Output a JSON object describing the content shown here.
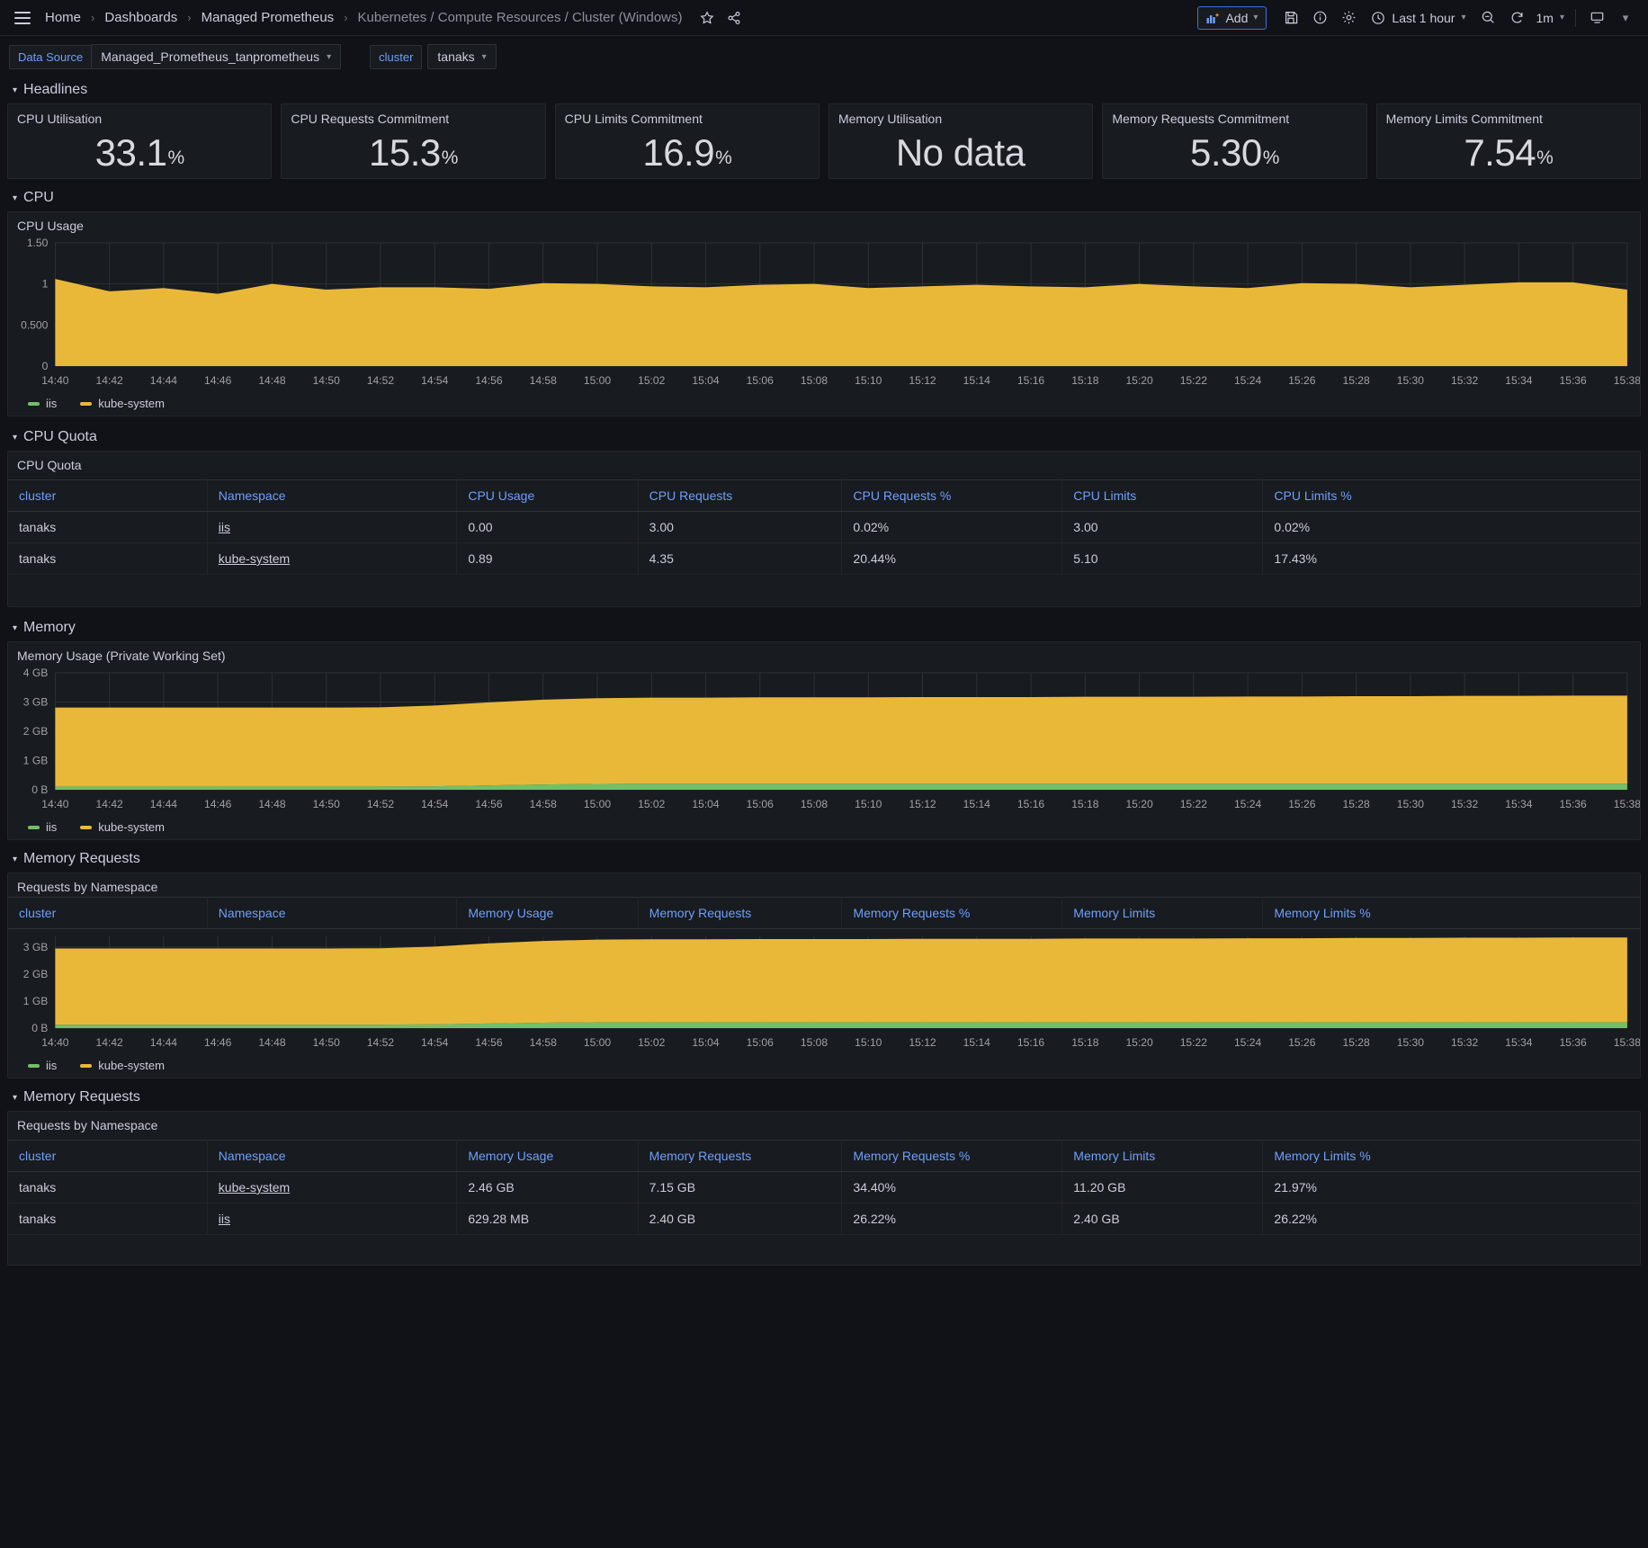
{
  "topbar": {
    "menu_icon": "hamburger-icon",
    "breadcrumbs": [
      {
        "label": "Home"
      },
      {
        "label": "Dashboards"
      },
      {
        "label": "Managed Prometheus"
      },
      {
        "label": "Kubernetes / Compute Resources / Cluster (Windows)"
      }
    ],
    "separator": "›",
    "star_icon": "☆",
    "share_icon": "share-icon",
    "add_label": "Add",
    "save_icon": "save-icon",
    "info_icon": "info-icon",
    "settings_icon": "gear-icon",
    "time_range": "Last 1 hour",
    "zoom_out_icon": "zoom-out-icon",
    "refresh_icon": "refresh-icon",
    "refresh_interval": "1m",
    "kiosk_icon": "tv-icon",
    "chevron": "⌄"
  },
  "variables": {
    "datasource_label": "Data Source",
    "datasource_value": "Managed_Prometheus_tanprometheus",
    "cluster_label": "cluster",
    "cluster_value": "tanaks"
  },
  "rows": {
    "headlines": "Headlines",
    "cpu": "CPU",
    "cpu_quota": "CPU Quota",
    "memory": "Memory",
    "memory_requests": "Memory Requests",
    "memory_requests2": "Memory Requests"
  },
  "stats": [
    {
      "title": "CPU Utilisation",
      "value": "33.1",
      "unit": "%"
    },
    {
      "title": "CPU Requests Commitment",
      "value": "15.3",
      "unit": "%"
    },
    {
      "title": "CPU Limits Commitment",
      "value": "16.9",
      "unit": "%"
    },
    {
      "title": "Memory Utilisation",
      "value": "No data",
      "unit": ""
    },
    {
      "title": "Memory Requests Commitment",
      "value": "5.30",
      "unit": "%"
    },
    {
      "title": "Memory Limits Commitment",
      "value": "7.54",
      "unit": "%"
    }
  ],
  "panels": {
    "cpu_usage_title": "CPU Usage",
    "cpu_quota_title": "CPU Quota",
    "memory_usage_title": "Memory Usage (Private Working Set)",
    "requests_by_namespace_title": "Requests by Namespace",
    "requests_by_namespace_title2": "Requests by Namespace"
  },
  "legend": [
    {
      "name": "iis",
      "color": "#73bf69"
    },
    {
      "name": "kube-system",
      "color": "#eab839"
    }
  ],
  "cpu_quota_table": {
    "columns": [
      "cluster",
      "Namespace",
      "CPU Usage",
      "CPU Requests",
      "CPU Requests %",
      "CPU Limits",
      "CPU Limits %"
    ],
    "rows": [
      [
        "tanaks",
        "iis",
        "0.00",
        "3.00",
        "0.02%",
        "3.00",
        "0.02%"
      ],
      [
        "tanaks",
        "kube-system",
        "0.89",
        "4.35",
        "20.44%",
        "5.10",
        "17.43%"
      ]
    ],
    "link_col": 1
  },
  "memory_requests_header": {
    "columns": [
      "cluster",
      "Namespace",
      "Memory Usage",
      "Memory Requests",
      "Memory Requests %",
      "Memory Limits",
      "Memory Limits %"
    ]
  },
  "memory_requests_table": {
    "columns": [
      "cluster",
      "Namespace",
      "Memory Usage",
      "Memory Requests",
      "Memory Requests %",
      "Memory Limits",
      "Memory Limits %"
    ],
    "rows": [
      [
        "tanaks",
        "kube-system",
        "2.46 GB",
        "7.15 GB",
        "34.40%",
        "11.20 GB",
        "21.97%"
      ],
      [
        "tanaks",
        "iis",
        "629.28 MB",
        "2.40 GB",
        "26.22%",
        "2.40 GB",
        "26.22%"
      ]
    ],
    "link_col": 1
  },
  "chart_data": [
    {
      "id": "cpu_usage",
      "type": "area",
      "title": "CPU Usage",
      "xlabel": "",
      "ylabel": "",
      "ylim": [
        0,
        1.5
      ],
      "ytick_labels": [
        "1.50",
        "1",
        "0.500",
        "0"
      ],
      "ytick_values": [
        1.5,
        1.0,
        0.5,
        0
      ],
      "grid": true,
      "legend_position": "bottom",
      "x": [
        "14:40",
        "14:42",
        "14:44",
        "14:46",
        "14:48",
        "14:50",
        "14:52",
        "14:54",
        "14:56",
        "14:58",
        "15:00",
        "15:02",
        "15:04",
        "15:06",
        "15:08",
        "15:10",
        "15:12",
        "15:14",
        "15:16",
        "15:18",
        "15:20",
        "15:22",
        "15:24",
        "15:26",
        "15:28",
        "15:30",
        "15:32",
        "15:34",
        "15:36",
        "15:38"
      ],
      "series": [
        {
          "name": "kube-system",
          "color": "#eab839",
          "values": [
            1.06,
            0.91,
            0.95,
            0.88,
            1.0,
            0.93,
            0.96,
            0.96,
            0.94,
            1.01,
            1.0,
            0.97,
            0.96,
            0.99,
            1.0,
            0.95,
            0.97,
            0.99,
            0.97,
            0.96,
            1.0,
            0.97,
            0.95,
            1.01,
            1.0,
            0.96,
            0.99,
            1.02,
            1.02,
            0.93
          ]
        },
        {
          "name": "iis",
          "color": "#73bf69",
          "values": [
            0.0,
            0.0,
            0.0,
            0.0,
            0.0,
            0.0,
            0.0,
            0.0,
            0.0,
            0.0,
            0.0,
            0.0,
            0.0,
            0.0,
            0.0,
            0.0,
            0.0,
            0.0,
            0.0,
            0.0,
            0.0,
            0.0,
            0.0,
            0.0,
            0.0,
            0.0,
            0.0,
            0.0,
            0.0,
            0.0
          ]
        }
      ]
    },
    {
      "id": "memory_usage",
      "type": "area",
      "title": "Memory Usage (Private Working Set)",
      "xlabel": "",
      "ylabel": "",
      "ylim": [
        0,
        4
      ],
      "ytick_labels": [
        "4 GB",
        "3 GB",
        "2 GB",
        "1 GB",
        "0 B"
      ],
      "ytick_values": [
        4,
        3,
        2,
        1,
        0
      ],
      "grid": true,
      "legend_position": "bottom",
      "x": [
        "14:40",
        "14:42",
        "14:44",
        "14:46",
        "14:48",
        "14:50",
        "14:52",
        "14:54",
        "14:56",
        "14:58",
        "15:00",
        "15:02",
        "15:04",
        "15:06",
        "15:08",
        "15:10",
        "15:12",
        "15:14",
        "15:16",
        "15:18",
        "15:20",
        "15:22",
        "15:24",
        "15:26",
        "15:28",
        "15:30",
        "15:32",
        "15:34",
        "15:36",
        "15:38"
      ],
      "series": [
        {
          "name": "iis",
          "color": "#73bf69",
          "values": [
            0.11,
            0.11,
            0.11,
            0.11,
            0.11,
            0.11,
            0.11,
            0.12,
            0.15,
            0.18,
            0.2,
            0.21,
            0.21,
            0.21,
            0.21,
            0.21,
            0.21,
            0.21,
            0.21,
            0.21,
            0.21,
            0.21,
            0.21,
            0.21,
            0.21,
            0.21,
            0.21,
            0.21,
            0.21,
            0.21
          ]
        },
        {
          "name": "kube-system",
          "color": "#eab839",
          "values": [
            2.7,
            2.7,
            2.7,
            2.7,
            2.7,
            2.7,
            2.71,
            2.76,
            2.84,
            2.9,
            2.93,
            2.94,
            2.94,
            2.95,
            2.95,
            2.95,
            2.96,
            2.96,
            2.96,
            2.97,
            2.97,
            2.97,
            2.98,
            2.98,
            2.99,
            2.99,
            3.0,
            3.0,
            3.01,
            3.01
          ]
        }
      ]
    },
    {
      "id": "requests_by_namespace",
      "type": "area",
      "title": "Requests by Namespace",
      "xlabel": "",
      "ylabel": "",
      "ylim": [
        0,
        3.4
      ],
      "ytick_labels": [
        "3 GB",
        "2 GB",
        "1 GB",
        "0 B"
      ],
      "ytick_values": [
        3,
        2,
        1,
        0
      ],
      "grid": true,
      "legend_position": "bottom",
      "x": [
        "14:40",
        "14:42",
        "14:44",
        "14:46",
        "14:48",
        "14:50",
        "14:52",
        "14:54",
        "14:56",
        "14:58",
        "15:00",
        "15:02",
        "15:04",
        "15:06",
        "15:08",
        "15:10",
        "15:12",
        "15:14",
        "15:16",
        "15:18",
        "15:20",
        "15:22",
        "15:24",
        "15:26",
        "15:28",
        "15:30",
        "15:32",
        "15:34",
        "15:36",
        "15:38"
      ],
      "series": [
        {
          "name": "iis",
          "color": "#73bf69",
          "values": [
            0.13,
            0.13,
            0.13,
            0.13,
            0.13,
            0.13,
            0.13,
            0.14,
            0.17,
            0.2,
            0.22,
            0.22,
            0.22,
            0.22,
            0.22,
            0.22,
            0.22,
            0.22,
            0.22,
            0.22,
            0.22,
            0.22,
            0.22,
            0.22,
            0.22,
            0.22,
            0.22,
            0.22,
            0.22,
            0.22
          ]
        },
        {
          "name": "kube-system",
          "color": "#eab839",
          "values": [
            2.82,
            2.82,
            2.82,
            2.82,
            2.82,
            2.82,
            2.83,
            2.88,
            2.97,
            3.03,
            3.06,
            3.07,
            3.07,
            3.08,
            3.08,
            3.08,
            3.09,
            3.09,
            3.09,
            3.1,
            3.1,
            3.1,
            3.11,
            3.11,
            3.12,
            3.12,
            3.13,
            3.13,
            3.14,
            3.14
          ]
        }
      ]
    }
  ]
}
